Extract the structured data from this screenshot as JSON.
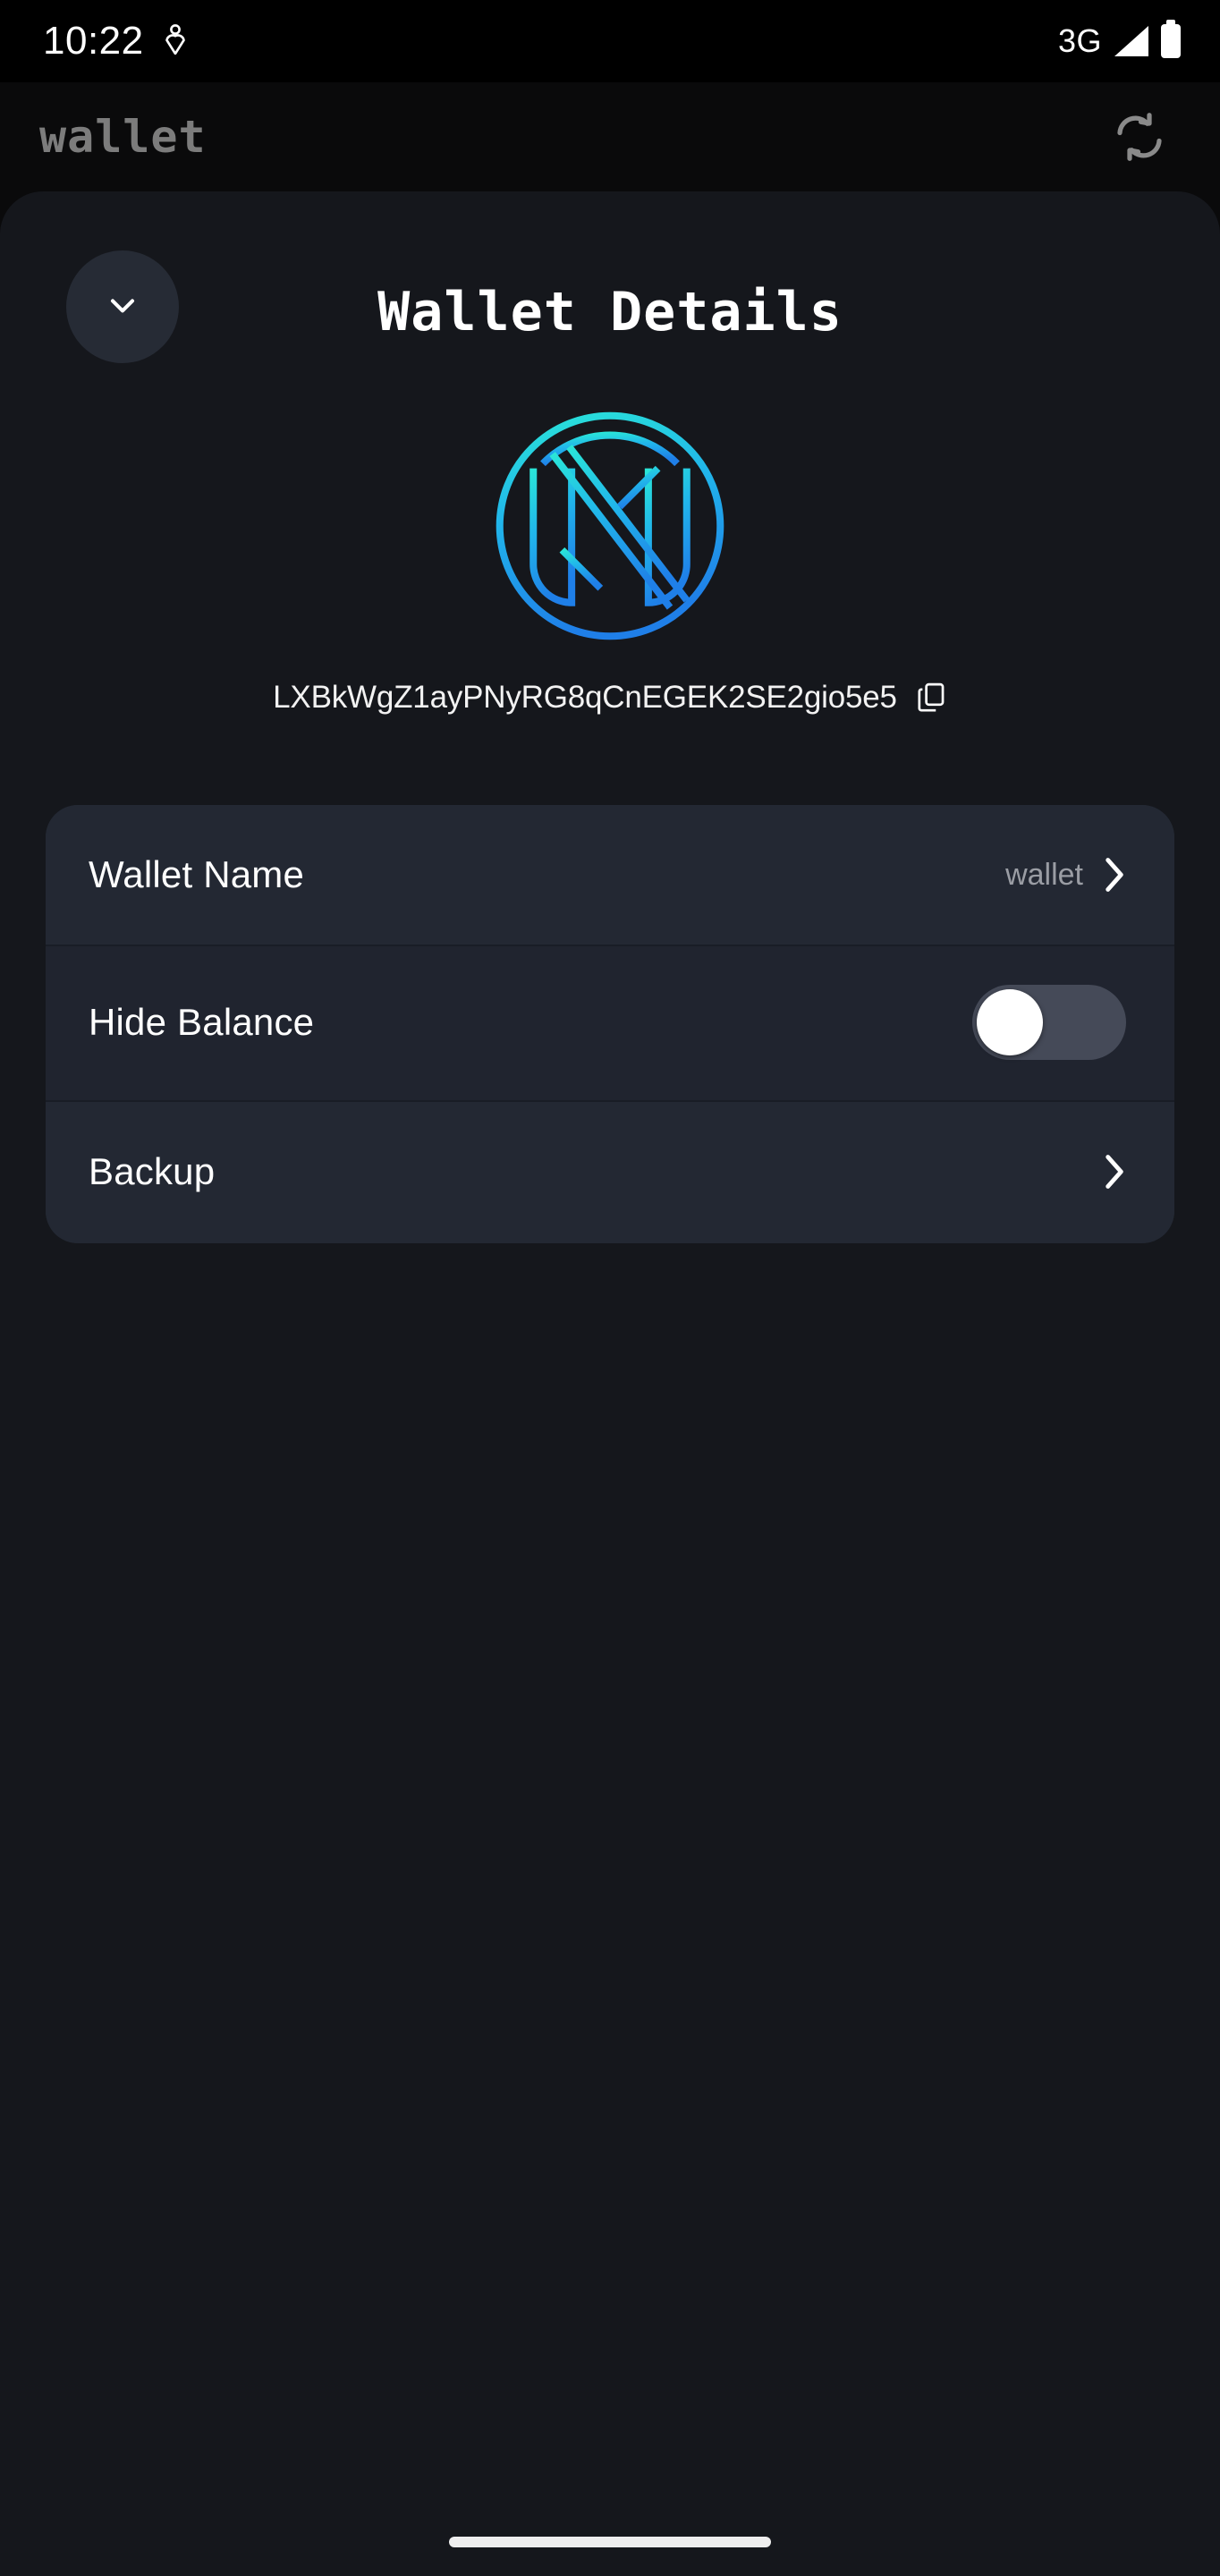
{
  "status_bar": {
    "time": "10:22",
    "left_icon": "location-heart-icon",
    "network": "3G",
    "signal_icon": "signal-bars-icon",
    "battery_icon": "battery-full-icon"
  },
  "app_bar": {
    "title": "wallet",
    "refresh_icon": "refresh-sync-icon"
  },
  "page": {
    "back_icon": "chevron-down-icon",
    "title": "Wallet Details",
    "logo_icon": "wallet-monogram-logo",
    "address": "LXBkWgZ1ayPNyRG8qCnEGEK2SE2gio5e5",
    "copy_icon": "copy-icon"
  },
  "settings": {
    "rows": [
      {
        "label": "Wallet Name",
        "value": "wallet",
        "accessory": "chevron-right-icon"
      },
      {
        "label": "Hide Balance",
        "value": "",
        "accessory": "toggle-switch-off"
      },
      {
        "label": "Backup",
        "value": "",
        "accessory": "chevron-right-icon"
      }
    ]
  },
  "colors": {
    "page_background": "#0a0a0b",
    "sheet_background": "#15171c",
    "card_background": "#232833",
    "card_alt_background": "#20242f",
    "accent_cyan": "#2ae6d8",
    "accent_blue": "#1f7fe8",
    "muted_text": "#9a9da4",
    "title_text": "#ffffff",
    "appbar_title": "#7c7c7c",
    "toggle_track": "#454a58",
    "toggle_knob": "#ffffff"
  },
  "nav": {
    "home_indicator": "home-indicator"
  }
}
